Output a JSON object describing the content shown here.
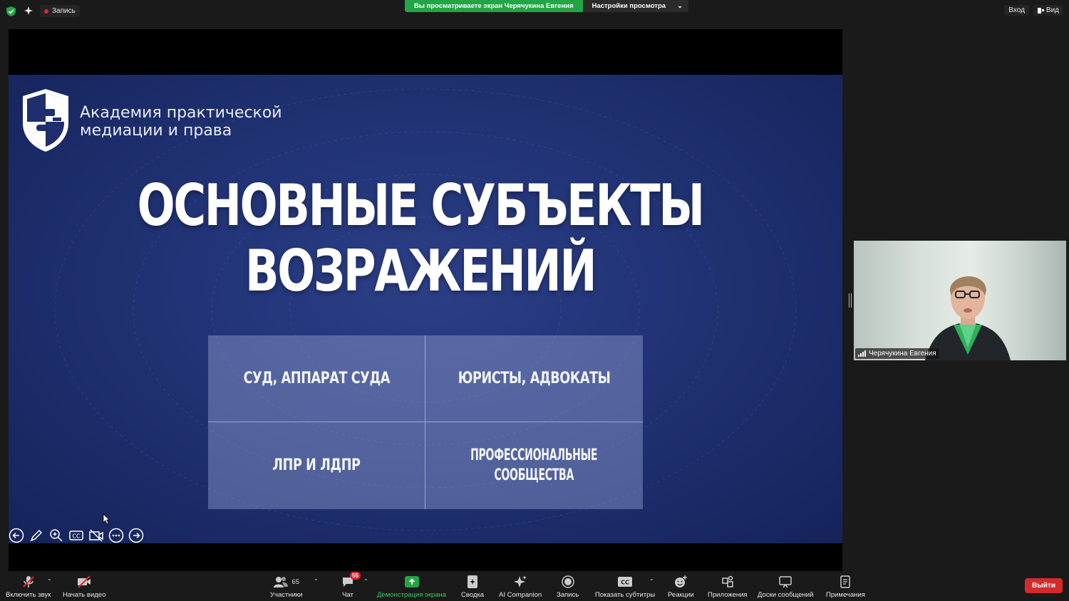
{
  "topbar": {
    "recording_label": "Запись",
    "share_banner": "Вы просматриваете экран Черячукина Евгения",
    "view_options": "Настройки просмотра",
    "signin": "Вход",
    "view": "Вид"
  },
  "slide": {
    "academy_line1": "Академия практической",
    "academy_line2": "медиации и права",
    "title_line1": "ОСНОВНЫЕ СУБЪЕКТЫ",
    "title_line2": "ВОЗРАЖЕНИЙ",
    "cells": [
      {
        "line1": "СУД, АППАРАТ СУДА",
        "line2": ""
      },
      {
        "line1": "ЮРИСТЫ, АДВОКАТЫ",
        "line2": ""
      },
      {
        "line1": "ЛПР И ЛДПР",
        "line2": ""
      },
      {
        "line1": "ПРОФЕССИОНАЛЬНЫЕ",
        "line2": "СООБЩЕСТВА"
      }
    ],
    "slide_tools": [
      "prev-slide-icon",
      "pen-icon",
      "zoom-icon",
      "cc-icon",
      "video-off-icon",
      "more-icon",
      "next-slide-icon"
    ]
  },
  "participant": {
    "name": "Черячукина Евгения"
  },
  "toolbar": {
    "unmute": "Включить звук",
    "start_video": "Начать видео",
    "participants": "Участники",
    "participants_count": "65",
    "chat": "Чат",
    "chat_badge": "55",
    "share_screen": "Демонстрация экрана",
    "summary": "Сводка",
    "ai_companion": "AI Companion",
    "record": "Запись",
    "captions": "Показать субтитры",
    "reactions": "Реакции",
    "apps": "Приложения",
    "whiteboards": "Доски сообщений",
    "notes": "Примечания",
    "leave": "Выйти"
  },
  "colors": {
    "accent_green": "#23a547",
    "leave_red": "#d42a2a",
    "slide_blue": "#223477"
  }
}
